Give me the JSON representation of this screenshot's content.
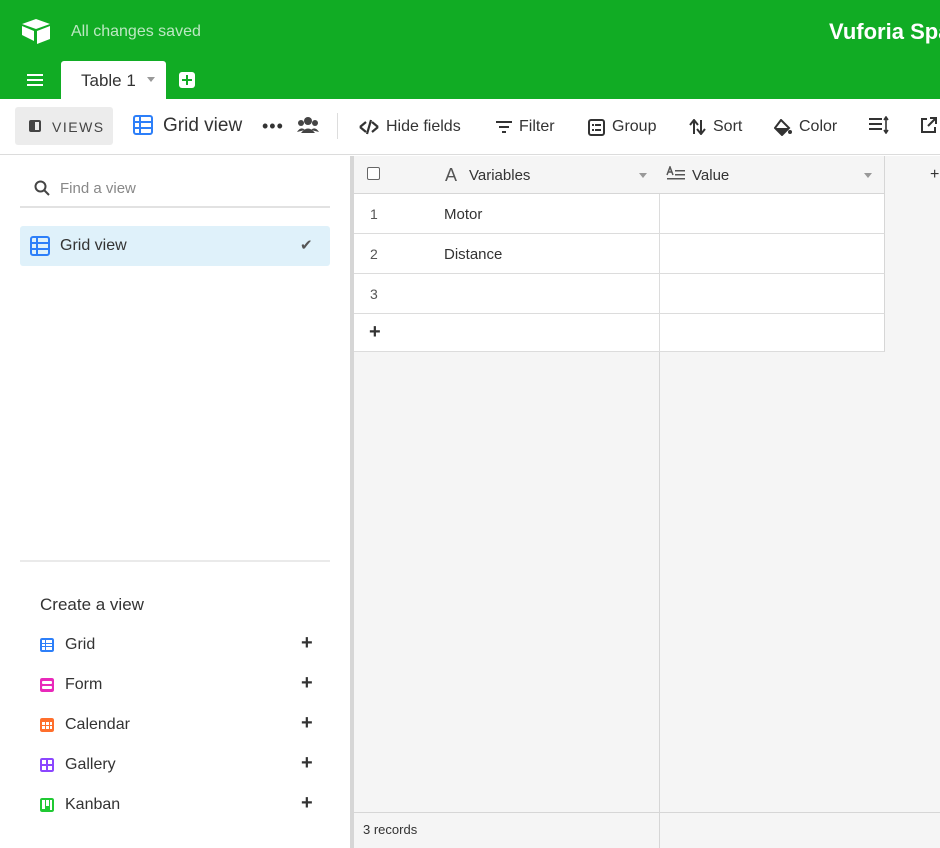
{
  "header": {
    "save_status": "All changes saved",
    "base_name": "Vuforia Spa",
    "logo_icon": "airtable-logo-icon",
    "brand_color": "#11ac24"
  },
  "tabs": [
    {
      "label": "Table 1",
      "active": true
    }
  ],
  "toolbar": {
    "views_label": "VIEWS",
    "view_name": "Grid view",
    "hide_fields": "Hide fields",
    "filter": "Filter",
    "group": "Group",
    "sort": "Sort",
    "color": "Color"
  },
  "sidebar": {
    "search_placeholder": "Find a view",
    "views": [
      {
        "label": "Grid view",
        "active": true,
        "icon": "grid-icon"
      }
    ],
    "create_title": "Create a view",
    "create_items": [
      {
        "label": "Grid",
        "icon": "grid-icon",
        "color": "#2d7ff9"
      },
      {
        "label": "Form",
        "icon": "form-icon",
        "color": "#e929ba"
      },
      {
        "label": "Calendar",
        "icon": "calendar-icon",
        "color": "#ff6f2c"
      },
      {
        "label": "Gallery",
        "icon": "gallery-icon",
        "color": "#8b46ff"
      },
      {
        "label": "Kanban",
        "icon": "kanban-icon",
        "color": "#20c933"
      }
    ]
  },
  "grid": {
    "columns": [
      {
        "label": "Variables",
        "icon": "text-icon"
      },
      {
        "label": "Value",
        "icon": "long-text-icon"
      }
    ],
    "rows": [
      {
        "num": "1",
        "variables": "Motor",
        "value": ""
      },
      {
        "num": "2",
        "variables": "Distance",
        "value": ""
      },
      {
        "num": "3",
        "variables": "",
        "value": ""
      }
    ],
    "add_field": "+",
    "footer": "3 records"
  }
}
